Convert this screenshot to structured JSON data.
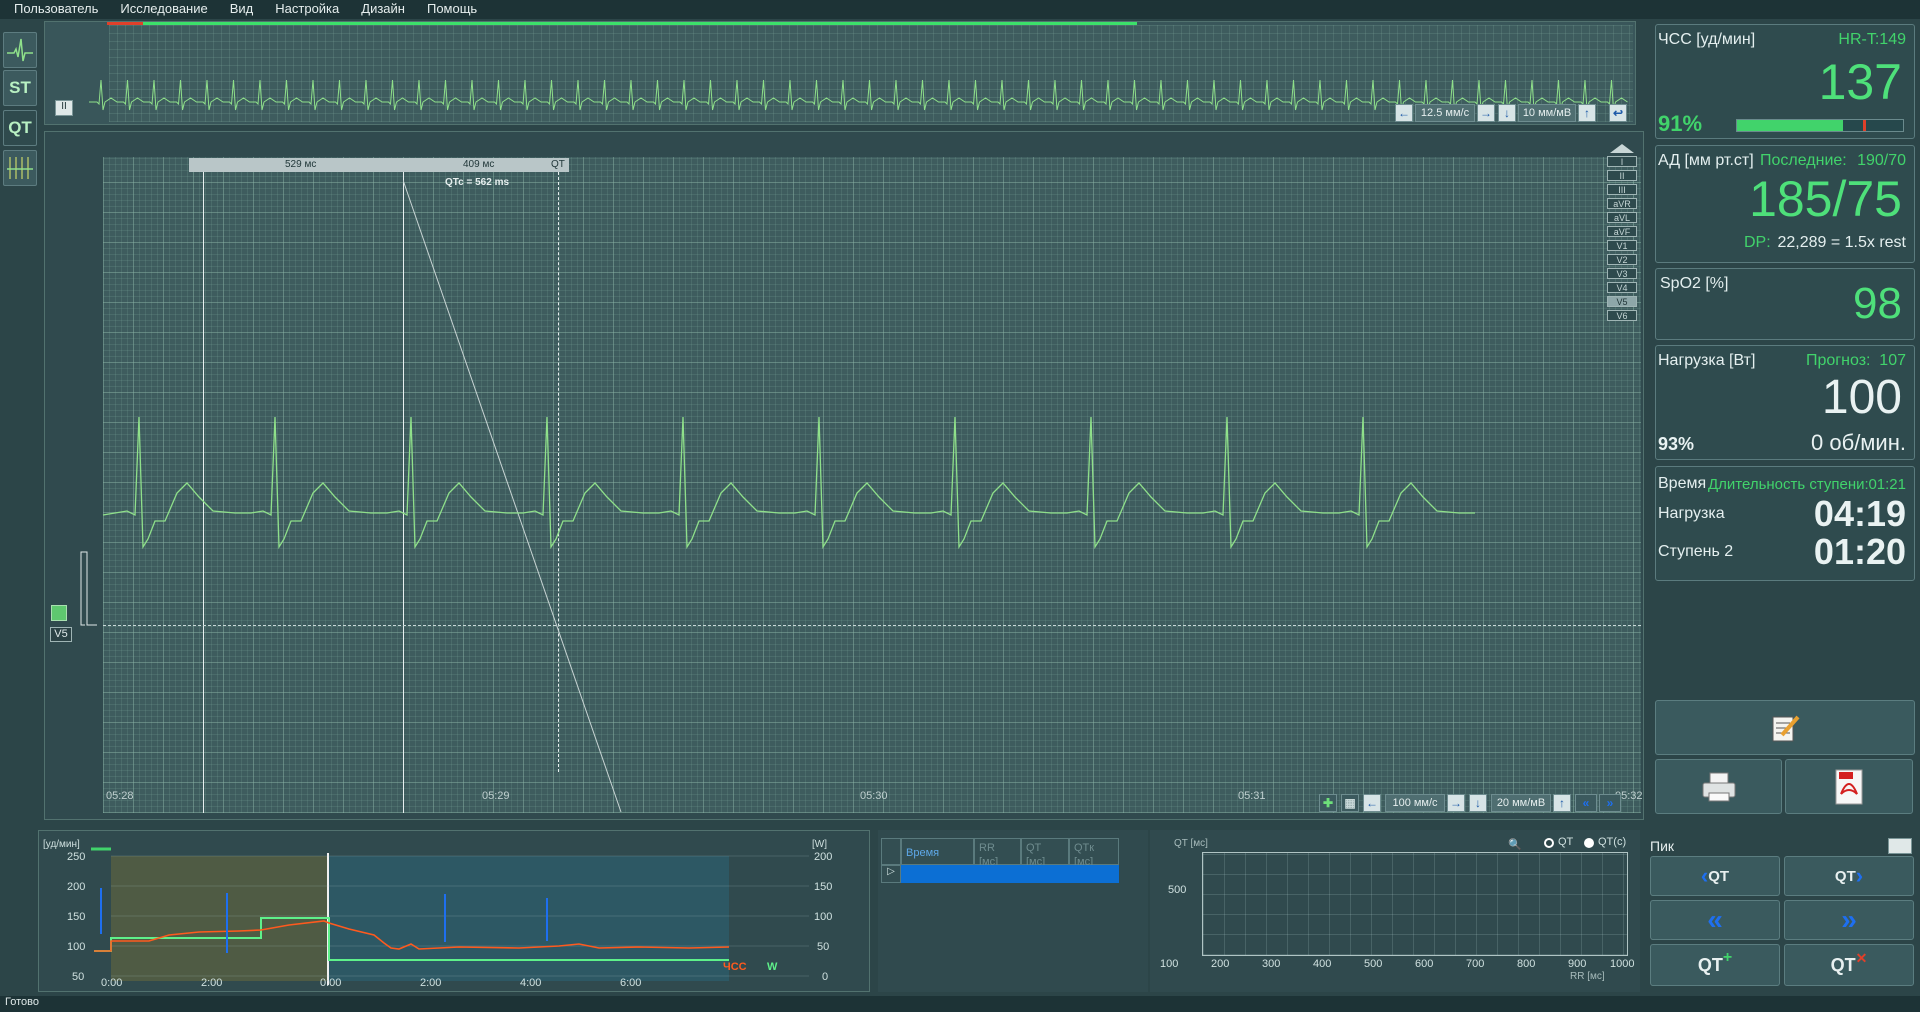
{
  "menu": [
    "Пользователь",
    "Исследование",
    "Вид",
    "Настройка",
    "Дизайн",
    "Помощь"
  ],
  "left_toolbar": [
    {
      "name": "ecg-view-icon",
      "label": ""
    },
    {
      "name": "st-view-icon",
      "label": "ST"
    },
    {
      "name": "qt-view-icon",
      "label": "QT"
    },
    {
      "name": "grid-view-icon",
      "label": ""
    }
  ],
  "overview": {
    "speed": "12.5 мм/с",
    "gain": "10 мм/мВ"
  },
  "main_ecg": {
    "lead_label": "V5",
    "measure_1": "529 мс",
    "measure_2": "409 мс",
    "measure_label": "QT",
    "qtc": "QTc = 562 ms",
    "times": [
      "05:28",
      "05:29",
      "05:30",
      "05:31",
      "05:32"
    ],
    "speed": "100 мм/с",
    "gain": "20 мм/мВ",
    "leads": [
      "I",
      "II",
      "III",
      "aVR",
      "aVL",
      "aVF",
      "V1",
      "V2",
      "V3",
      "V4",
      "V5",
      "V6"
    ],
    "selected_lead": "V5"
  },
  "vitals": {
    "hr": {
      "label": "ЧСС [уд/мин]",
      "target": "HR-T:149",
      "value": "137",
      "percent": "91%",
      "bar_fraction": 0.91
    },
    "bp": {
      "label": "АД [мм рт.ст]",
      "last_label": "Последние:",
      "last_value": "190/70",
      "value": "185/75",
      "dp_label": "DP:",
      "dp_value": "22,289 = 1.5x rest"
    },
    "spo2": {
      "label": "SpO2 [%]",
      "value": "98"
    },
    "load": {
      "label": "Нагрузка [Вт]",
      "forecast_label": "Прогноз:",
      "forecast_value": "107",
      "value": "100",
      "percent": "93%",
      "rpm": "0 об/мин."
    },
    "time": {
      "label": "Время",
      "stage_dur_label": "Длительность ступени:",
      "stage_dur": "01:21",
      "load_label": "Нагрузка",
      "load_time": "04:19",
      "stage_label": "Ступень 2",
      "stage_time": "01:20"
    }
  },
  "trend": {
    "y_left_title": "[уд/мин]",
    "y_left_ticks": [
      "250",
      "200",
      "150",
      "100",
      "50"
    ],
    "y_right_title": "[W]",
    "y_right_ticks": [
      "200",
      "150",
      "100",
      "50",
      "0"
    ],
    "x_ticks": [
      "0:00",
      "2:00",
      "0:00",
      "2:00",
      "4:00",
      "6:00"
    ],
    "legend_hr": "ЧСС",
    "legend_w": "W"
  },
  "qt_table": {
    "columns": [
      "Время",
      "RR\n[мс]",
      "QT\n[мс]",
      "QTк\n[мс]"
    ]
  },
  "qt_plot": {
    "ylabel": "QT [мс]",
    "ytick": "500",
    "xticks": [
      "100",
      "200",
      "300",
      "400",
      "500",
      "600",
      "700",
      "800",
      "900",
      "1000"
    ],
    "xlabel": "RR [мс]",
    "radio_qt": "QT",
    "radio_qtc": "QT(c)"
  },
  "peak_panel": {
    "label": "Пик"
  },
  "status": "Готово",
  "colors": {
    "ecg": "#8fe08a",
    "hr_green": "#4ee07a",
    "trend_hr": "#ff5a1e",
    "trend_w": "#5ef08a",
    "accent_blue": "#1e6ff0"
  }
}
